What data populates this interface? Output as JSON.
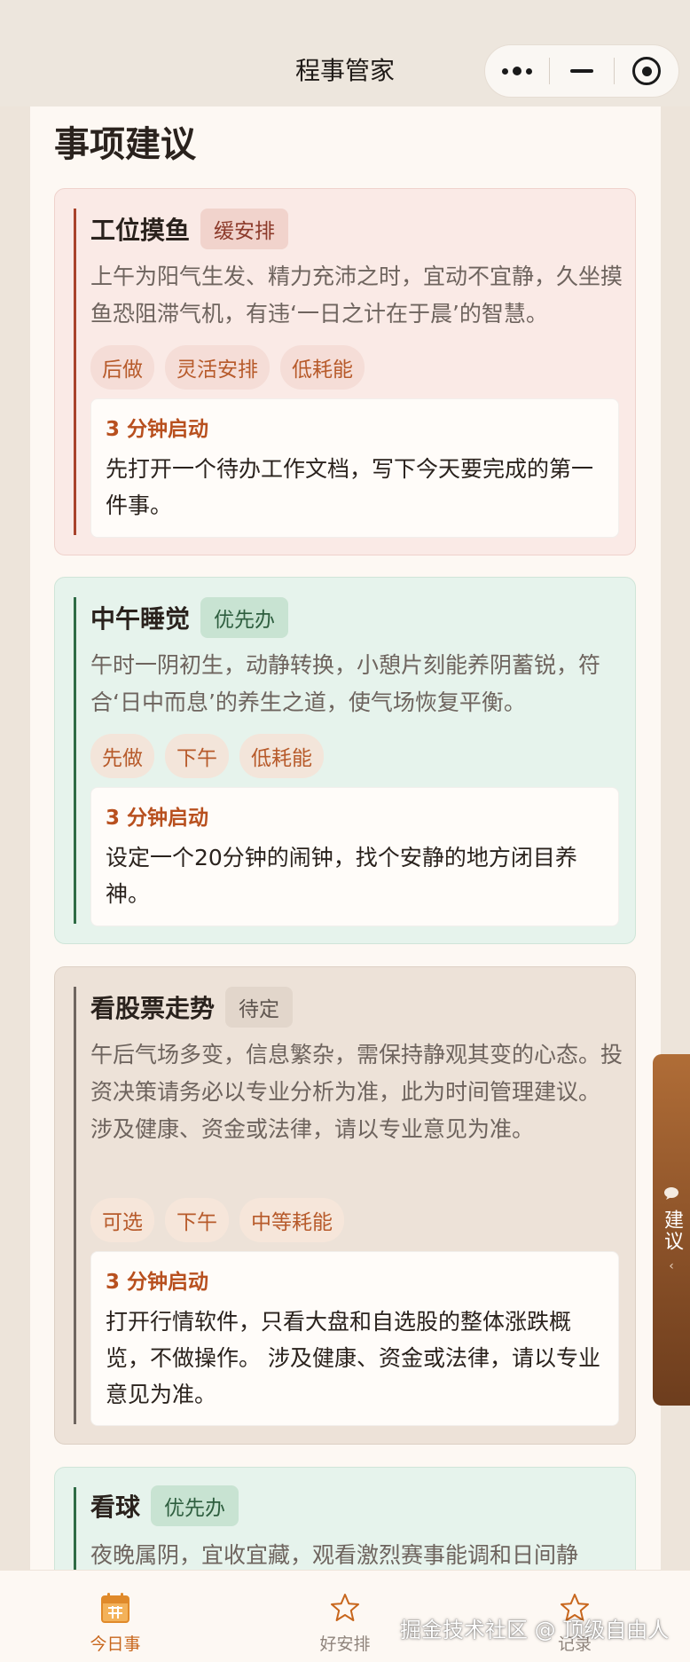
{
  "nav": {
    "title": "程事管家"
  },
  "page": {
    "section_title": "事项建议"
  },
  "cards": [
    {
      "title": "工位摸鱼",
      "status": "缓安排",
      "description": "上午为阳气生发、精力充沛之时，宜动不宜静，久坐摸鱼恐阻滞气机，有违‘一日之计在于晨’的智慧。",
      "tags": [
        "后做",
        "灵活安排",
        "低耗能"
      ],
      "starter_title": "3 分钟启动",
      "starter_text": "先打开一个待办工作文档，写下今天要完成的第一件事。",
      "colors": {
        "bg": "#faeae6",
        "border": "#efd2cc",
        "bar": "#a8432c",
        "status_bg": "#f1d3cc",
        "status_fg": "#8c3a2a",
        "tag_bg": "#f5ddd7"
      }
    },
    {
      "title": "中午睡觉",
      "status": "优先办",
      "description": "午时一阴初生，动静转换，小憩片刻能养阴蓄锐，符合‘日中而息’的养生之道，使气场恢复平衡。",
      "tags": [
        "先做",
        "下午",
        "低耗能"
      ],
      "starter_title": "3 分钟启动",
      "starter_text": "设定一个20分钟的闹钟，找个安静的地方闭目养神。",
      "colors": {
        "bg": "#e6f3ec",
        "border": "#cfe5d8",
        "bar": "#2f6b45",
        "status_bg": "#c8e3d2",
        "status_fg": "#2e5e3f",
        "tag_bg": "#f3e5da"
      }
    },
    {
      "title": "看股票走势",
      "status": "待定",
      "description": "午后气场多变，信息繁杂，需保持静观其变的心态。投资决策请务必以专业分析为准，此为时间管理建议。 涉及健康、资金或法律，请以专业意见为准。",
      "tags": [
        "可选",
        "下午",
        "中等耗能"
      ],
      "starter_title": "3 分钟启动",
      "starter_text": "打开行情软件，只看大盘和自选股的整体涨跌概览，不做操作。 涉及健康、资金或法律，请以专业意见为准。",
      "colors": {
        "bg": "#ede2d8",
        "border": "#ddd0c4",
        "bar": "#6f6660",
        "status_bg": "#e2d6cb",
        "status_fg": "#5e554f",
        "tag_bg": "#f6e6da"
      }
    },
    {
      "title": "看球",
      "status": "优先办",
      "description": "夜晚属阴，宜收宜藏，观看激烈赛事能调和日间静",
      "colors": {
        "bg": "#e6f3ec",
        "border": "#cfe5d8",
        "bar": "#2f6b45",
        "status_bg": "#c8e3d2",
        "status_fg": "#2e5e3f"
      }
    }
  ],
  "side_tab": {
    "label": "建议",
    "icon": "chat-bubble-icon"
  },
  "tabbar": {
    "items": [
      {
        "label": "今日事",
        "icon": "calendar-icon",
        "active": true
      },
      {
        "label": "好安排",
        "icon": "star-icon",
        "active": false
      },
      {
        "label": "记录",
        "icon": "star-icon",
        "active": false
      }
    ],
    "active_color": "#c8661c",
    "inactive_color": "#8f847c"
  },
  "watermark": "掘金技术社区 @ 顶级自由人"
}
